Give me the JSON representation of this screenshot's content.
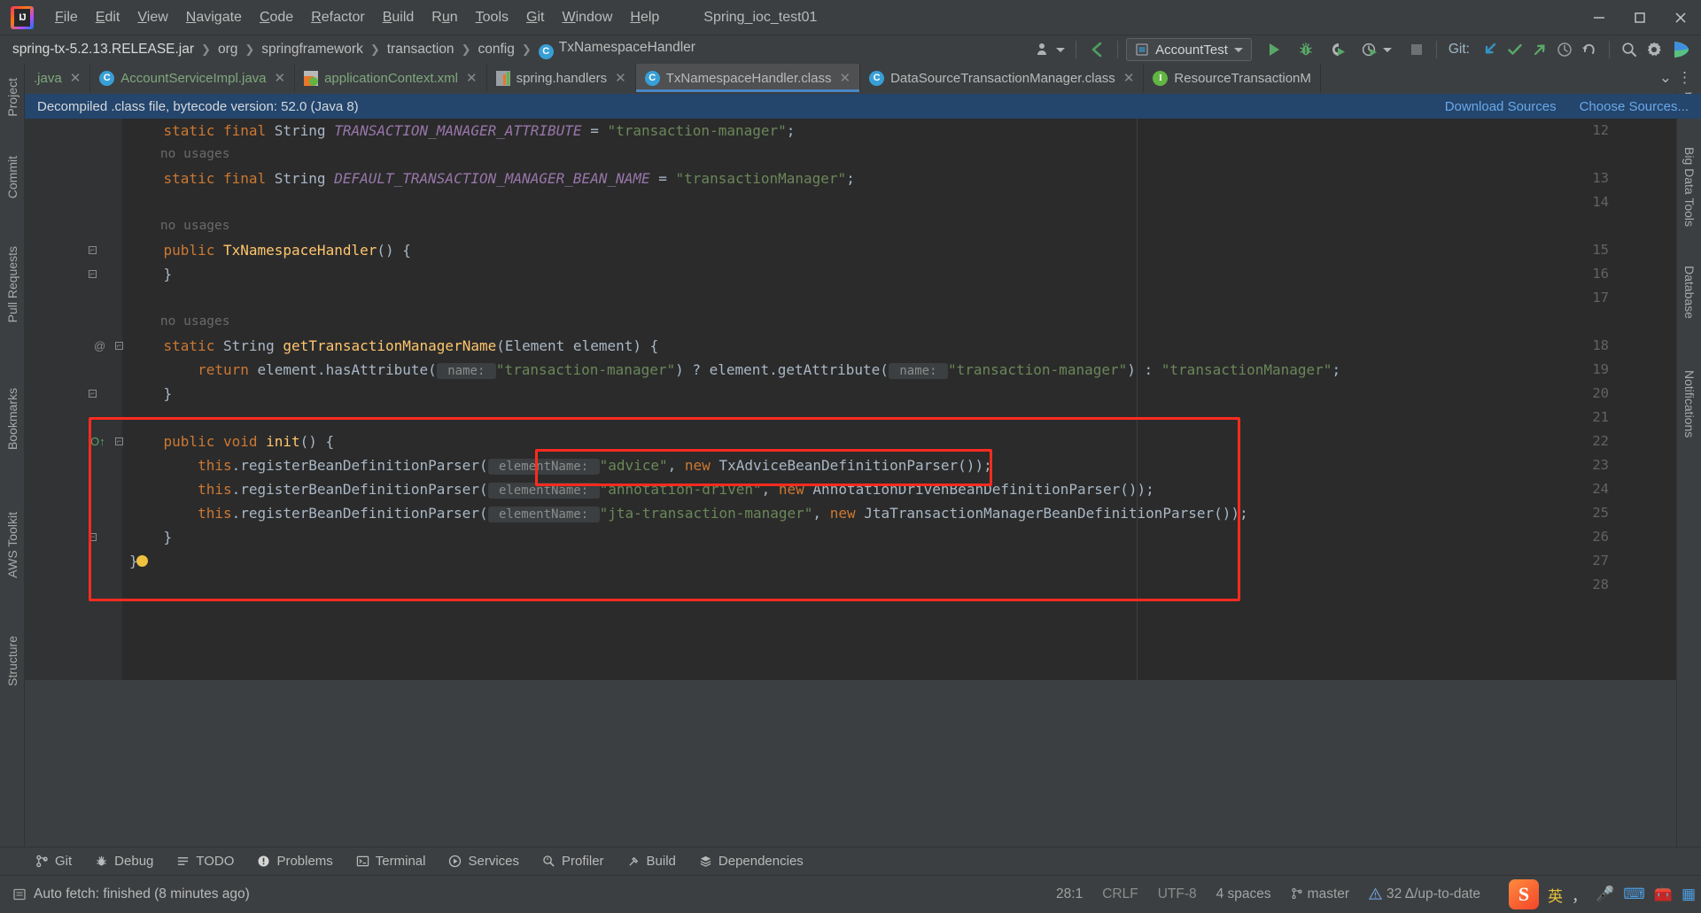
{
  "window": {
    "title": "Spring_ioc_test01",
    "app_icon": "intellij-idea-logo"
  },
  "menubar": {
    "items": [
      {
        "label": "File",
        "mnemonic": "F"
      },
      {
        "label": "Edit",
        "mnemonic": "E"
      },
      {
        "label": "View",
        "mnemonic": "V"
      },
      {
        "label": "Navigate",
        "mnemonic": "N"
      },
      {
        "label": "Code",
        "mnemonic": "C"
      },
      {
        "label": "Refactor",
        "mnemonic": "R"
      },
      {
        "label": "Build",
        "mnemonic": "B"
      },
      {
        "label": "Run",
        "mnemonic": "u"
      },
      {
        "label": "Tools",
        "mnemonic": "T"
      },
      {
        "label": "Git",
        "mnemonic": "G"
      },
      {
        "label": "Window",
        "mnemonic": "W"
      },
      {
        "label": "Help",
        "mnemonic": "H"
      }
    ]
  },
  "window_controls": {
    "minimize": "minimize-icon",
    "maximize": "maximize-icon",
    "close": "close-icon"
  },
  "breadcrumb": {
    "items": [
      {
        "label": "spring-tx-5.2.13.RELEASE.jar",
        "icon": null
      },
      {
        "label": "org",
        "icon": null
      },
      {
        "label": "springframework",
        "icon": null
      },
      {
        "label": "transaction",
        "icon": null
      },
      {
        "label": "config",
        "icon": null
      },
      {
        "label": "TxNamespaceHandler",
        "icon": "class-icon",
        "icon_letter": "C"
      }
    ]
  },
  "toolbar": {
    "profile_icon": "user-profile-icon",
    "back_icon": "back-arrow-icon",
    "run_config": {
      "label": "AccountTest",
      "icon": "run-configuration-icon"
    },
    "run_icon": "run-play-icon",
    "debug_icon": "debug-bug-icon",
    "run_coverage_icon": "run-with-coverage-icon",
    "profiler_icon": "run-profiler-icon",
    "stop_icon": "stop-square-icon",
    "git_label": "Git:",
    "git_update_icon": "update-project-icon",
    "git_commit_icon": "commit-checkmark-icon",
    "git_push_icon": "push-arrow-icon",
    "git_history_icon": "history-clock-icon",
    "git_rollback_icon": "rollback-undo-icon",
    "search_icon": "search-magnifier-icon",
    "settings_icon": "settings-gear-icon",
    "plugin_icon": "colorful-plugin-icon"
  },
  "tabs": [
    {
      "label": ".java",
      "icon": null,
      "closable": true,
      "active": false,
      "kind": "java"
    },
    {
      "label": "AccountServiceImpl.java",
      "icon": "class-icon",
      "icon_letter": "C",
      "closable": true,
      "active": false,
      "kind": "java"
    },
    {
      "label": "applicationContext.xml",
      "icon": "xml-spring-icon",
      "closable": true,
      "active": false,
      "kind": "xml"
    },
    {
      "label": "spring.handlers",
      "icon": "properties-icon",
      "closable": true,
      "active": false,
      "kind": "props"
    },
    {
      "label": "TxNamespaceHandler.class",
      "icon": "class-icon",
      "icon_letter": "C",
      "closable": true,
      "active": true,
      "kind": "class"
    },
    {
      "label": "DataSourceTransactionManager.class",
      "icon": "class-icon",
      "icon_letter": "C",
      "closable": true,
      "active": false,
      "kind": "class"
    },
    {
      "label": "ResourceTransactionM",
      "icon": "interface-icon",
      "icon_letter": "I",
      "closable": false,
      "active": false,
      "kind": "class"
    }
  ],
  "tabbar_right": {
    "chevron_icon": "chevron-down-icon",
    "more_icon": "more-vertical-icon"
  },
  "notification": {
    "text": "Decompiled .class file, bytecode version: 52.0 (Java 8)",
    "links": [
      "Download Sources",
      "Choose Sources..."
    ]
  },
  "left_toolwindows": [
    {
      "label": "Project",
      "icon": "project-icon"
    },
    {
      "label": "Commit",
      "icon": "commit-icon"
    },
    {
      "label": "Pull Requests",
      "icon": "pull-request-icon"
    },
    {
      "label": "Bookmarks",
      "icon": "bookmark-icon"
    },
    {
      "label": "AWS Toolkit",
      "icon": "aws-icon"
    },
    {
      "label": "Structure",
      "icon": "structure-icon"
    }
  ],
  "right_toolwindows": [
    {
      "label": "Maven",
      "icon": "maven-icon"
    },
    {
      "label": "Big Data Tools",
      "icon": "bigdata-icon"
    },
    {
      "label": "Database",
      "icon": "database-icon"
    },
    {
      "label": "Notifications",
      "icon": "notifications-icon"
    }
  ],
  "editor": {
    "language": "java",
    "lines": [
      {
        "num": "12",
        "usages": null,
        "text": "    static final String TRANSACTION_MANAGER_ATTRIBUTE = \"transaction-manager\";",
        "tokens": [
          {
            "t": "    ",
            "c": "plain"
          },
          {
            "t": "static final ",
            "c": "kw"
          },
          {
            "t": "String ",
            "c": "typ"
          },
          {
            "t": "TRANSACTION_MANAGER_ATTRIBUTE",
            "c": "fld"
          },
          {
            "t": " = ",
            "c": "plain"
          },
          {
            "t": "\"transaction-manager\"",
            "c": "str"
          },
          {
            "t": ";",
            "c": "plain"
          }
        ]
      },
      {
        "num": null,
        "usages": "    no usages",
        "text": null,
        "tokens": []
      },
      {
        "num": "13",
        "usages": null,
        "text": "    static final String DEFAULT_TRANSACTION_MANAGER_BEAN_NAME = \"transactionManager\";",
        "tokens": [
          {
            "t": "    ",
            "c": "plain"
          },
          {
            "t": "static final ",
            "c": "kw"
          },
          {
            "t": "String ",
            "c": "typ"
          },
          {
            "t": "DEFAULT_TRANSACTION_MANAGER_BEAN_NAME",
            "c": "fld"
          },
          {
            "t": " = ",
            "c": "plain"
          },
          {
            "t": "\"transactionManager\"",
            "c": "str"
          },
          {
            "t": ";",
            "c": "plain"
          }
        ]
      },
      {
        "num": "14",
        "usages": null,
        "text": "",
        "tokens": []
      },
      {
        "num": null,
        "usages": "    no usages",
        "text": null,
        "tokens": []
      },
      {
        "num": "15",
        "usages": null,
        "text": "    public TxNamespaceHandler() {",
        "tokens": [
          {
            "t": "    ",
            "c": "plain"
          },
          {
            "t": "public ",
            "c": "kw"
          },
          {
            "t": "TxNamespaceHandler",
            "c": "mth"
          },
          {
            "t": "() {",
            "c": "plain"
          }
        ]
      },
      {
        "num": "16",
        "usages": null,
        "text": "    }",
        "tokens": [
          {
            "t": "    }",
            "c": "plain"
          }
        ]
      },
      {
        "num": "17",
        "usages": null,
        "text": "",
        "tokens": []
      },
      {
        "num": null,
        "usages": "    no usages",
        "text": null,
        "tokens": []
      },
      {
        "num": "18",
        "usages": null,
        "text": "    static String getTransactionManagerName(Element element) {",
        "tokens": [
          {
            "t": "    ",
            "c": "plain"
          },
          {
            "t": "static ",
            "c": "kw"
          },
          {
            "t": "String ",
            "c": "typ"
          },
          {
            "t": "getTransactionManagerName",
            "c": "mth"
          },
          {
            "t": "(Element element) {",
            "c": "plain"
          }
        ]
      },
      {
        "num": "19",
        "usages": null,
        "text": "        return element.hasAttribute( name: \"transaction-manager\") ? element.getAttribute( name: \"transaction-manager\") : \"transactionManager\";",
        "tokens": [
          {
            "t": "        ",
            "c": "plain"
          },
          {
            "t": "return ",
            "c": "kw"
          },
          {
            "t": "element.hasAttribute(",
            "c": "plain"
          },
          {
            "t": " name: ",
            "c": "hint"
          },
          {
            "t": "\"transaction-manager\"",
            "c": "str"
          },
          {
            "t": ") ? element.getAttribute(",
            "c": "plain"
          },
          {
            "t": " name: ",
            "c": "hint"
          },
          {
            "t": "\"transaction-manager\"",
            "c": "str"
          },
          {
            "t": ") : ",
            "c": "plain"
          },
          {
            "t": "\"transactionManager\"",
            "c": "str"
          },
          {
            "t": ";",
            "c": "plain"
          }
        ]
      },
      {
        "num": "20",
        "usages": null,
        "text": "    }",
        "tokens": [
          {
            "t": "    }",
            "c": "plain"
          }
        ]
      },
      {
        "num": "21",
        "usages": null,
        "text": "",
        "tokens": []
      },
      {
        "num": "22",
        "usages": null,
        "text": "    public void init() {",
        "tokens": [
          {
            "t": "    ",
            "c": "plain"
          },
          {
            "t": "public void ",
            "c": "kw"
          },
          {
            "t": "init",
            "c": "mth"
          },
          {
            "t": "() {",
            "c": "plain"
          }
        ]
      },
      {
        "num": "23",
        "usages": null,
        "text": "        this.registerBeanDefinitionParser( elementName: \"advice\", new TxAdviceBeanDefinitionParser());",
        "tokens": [
          {
            "t": "        ",
            "c": "plain"
          },
          {
            "t": "this",
            "c": "kw"
          },
          {
            "t": ".registerBeanDefinitionParser(",
            "c": "plain"
          },
          {
            "t": " elementName: ",
            "c": "hint"
          },
          {
            "t": "\"advice\"",
            "c": "str"
          },
          {
            "t": ", ",
            "c": "plain"
          },
          {
            "t": "new ",
            "c": "kw"
          },
          {
            "t": "TxAdviceBeanDefinitionParser());",
            "c": "plain"
          }
        ]
      },
      {
        "num": "24",
        "usages": null,
        "text": "        this.registerBeanDefinitionParser( elementName: \"annotation-driven\", new AnnotationDrivenBeanDefinitionParser());",
        "tokens": [
          {
            "t": "        ",
            "c": "plain"
          },
          {
            "t": "this",
            "c": "kw"
          },
          {
            "t": ".registerBeanDefinitionParser(",
            "c": "plain"
          },
          {
            "t": " elementName: ",
            "c": "hint"
          },
          {
            "t": "\"annotation-driven\"",
            "c": "str"
          },
          {
            "t": ", ",
            "c": "plain"
          },
          {
            "t": "new ",
            "c": "kw"
          },
          {
            "t": "AnnotationDrivenBeanDefinitionParser());",
            "c": "plain"
          }
        ]
      },
      {
        "num": "25",
        "usages": null,
        "text": "        this.registerBeanDefinitionParser( elementName: \"jta-transaction-manager\", new JtaTransactionManagerBeanDefinitionParser());",
        "tokens": [
          {
            "t": "        ",
            "c": "plain"
          },
          {
            "t": "this",
            "c": "kw"
          },
          {
            "t": ".registerBeanDefinitionParser(",
            "c": "plain"
          },
          {
            "t": " elementName: ",
            "c": "hint"
          },
          {
            "t": "\"jta-transaction-manager\"",
            "c": "str"
          },
          {
            "t": ", ",
            "c": "plain"
          },
          {
            "t": "new ",
            "c": "kw"
          },
          {
            "t": "JtaTransactionManagerBeanDefinitionParser());",
            "c": "plain"
          }
        ]
      },
      {
        "num": "26",
        "usages": null,
        "text": "    }",
        "tokens": [
          {
            "t": "    }",
            "c": "plain"
          }
        ]
      },
      {
        "num": "27",
        "usages": null,
        "text": "}",
        "tokens": [
          {
            "t": "}",
            "c": "plain"
          }
        ]
      },
      {
        "num": "28",
        "usages": null,
        "text": "",
        "tokens": []
      }
    ]
  },
  "annotations": {
    "outer_box_color": "#fe2b1f",
    "inner_box_color": "#fe2b1f"
  },
  "bottom_toolwindows": [
    {
      "label": "Git",
      "icon": "git-branch-icon"
    },
    {
      "label": "Debug",
      "icon": "debug-bug-icon"
    },
    {
      "label": "TODO",
      "icon": "todo-list-icon"
    },
    {
      "label": "Problems",
      "icon": "problems-warning-icon"
    },
    {
      "label": "Terminal",
      "icon": "terminal-icon"
    },
    {
      "label": "Services",
      "icon": "services-icon"
    },
    {
      "label": "Profiler",
      "icon": "profiler-icon"
    },
    {
      "label": "Build",
      "icon": "build-hammer-icon"
    },
    {
      "label": "Dependencies",
      "icon": "dependencies-icon"
    }
  ],
  "statusbar": {
    "message": "Auto fetch: finished (8 minutes ago)",
    "message_icon": "info-icon",
    "caret_position": "28:1",
    "line_separator": "CRLF",
    "encoding": "UTF-8",
    "indent": "4 spaces",
    "branch": "master",
    "branch_icon": "git-branch-icon",
    "sync_status": "32 Δ/up-to-date",
    "sync_icon": "warning-triangle-icon",
    "ime": {
      "logo": "S",
      "mode": "英",
      "punctuation_icon": "punctuation-icon",
      "voice_icon": "microphone-icon",
      "keyboard_icon": "keyboard-icon",
      "toolbox_icon": "toolbox-icon",
      "menu_icon": "grid-menu-icon"
    }
  }
}
